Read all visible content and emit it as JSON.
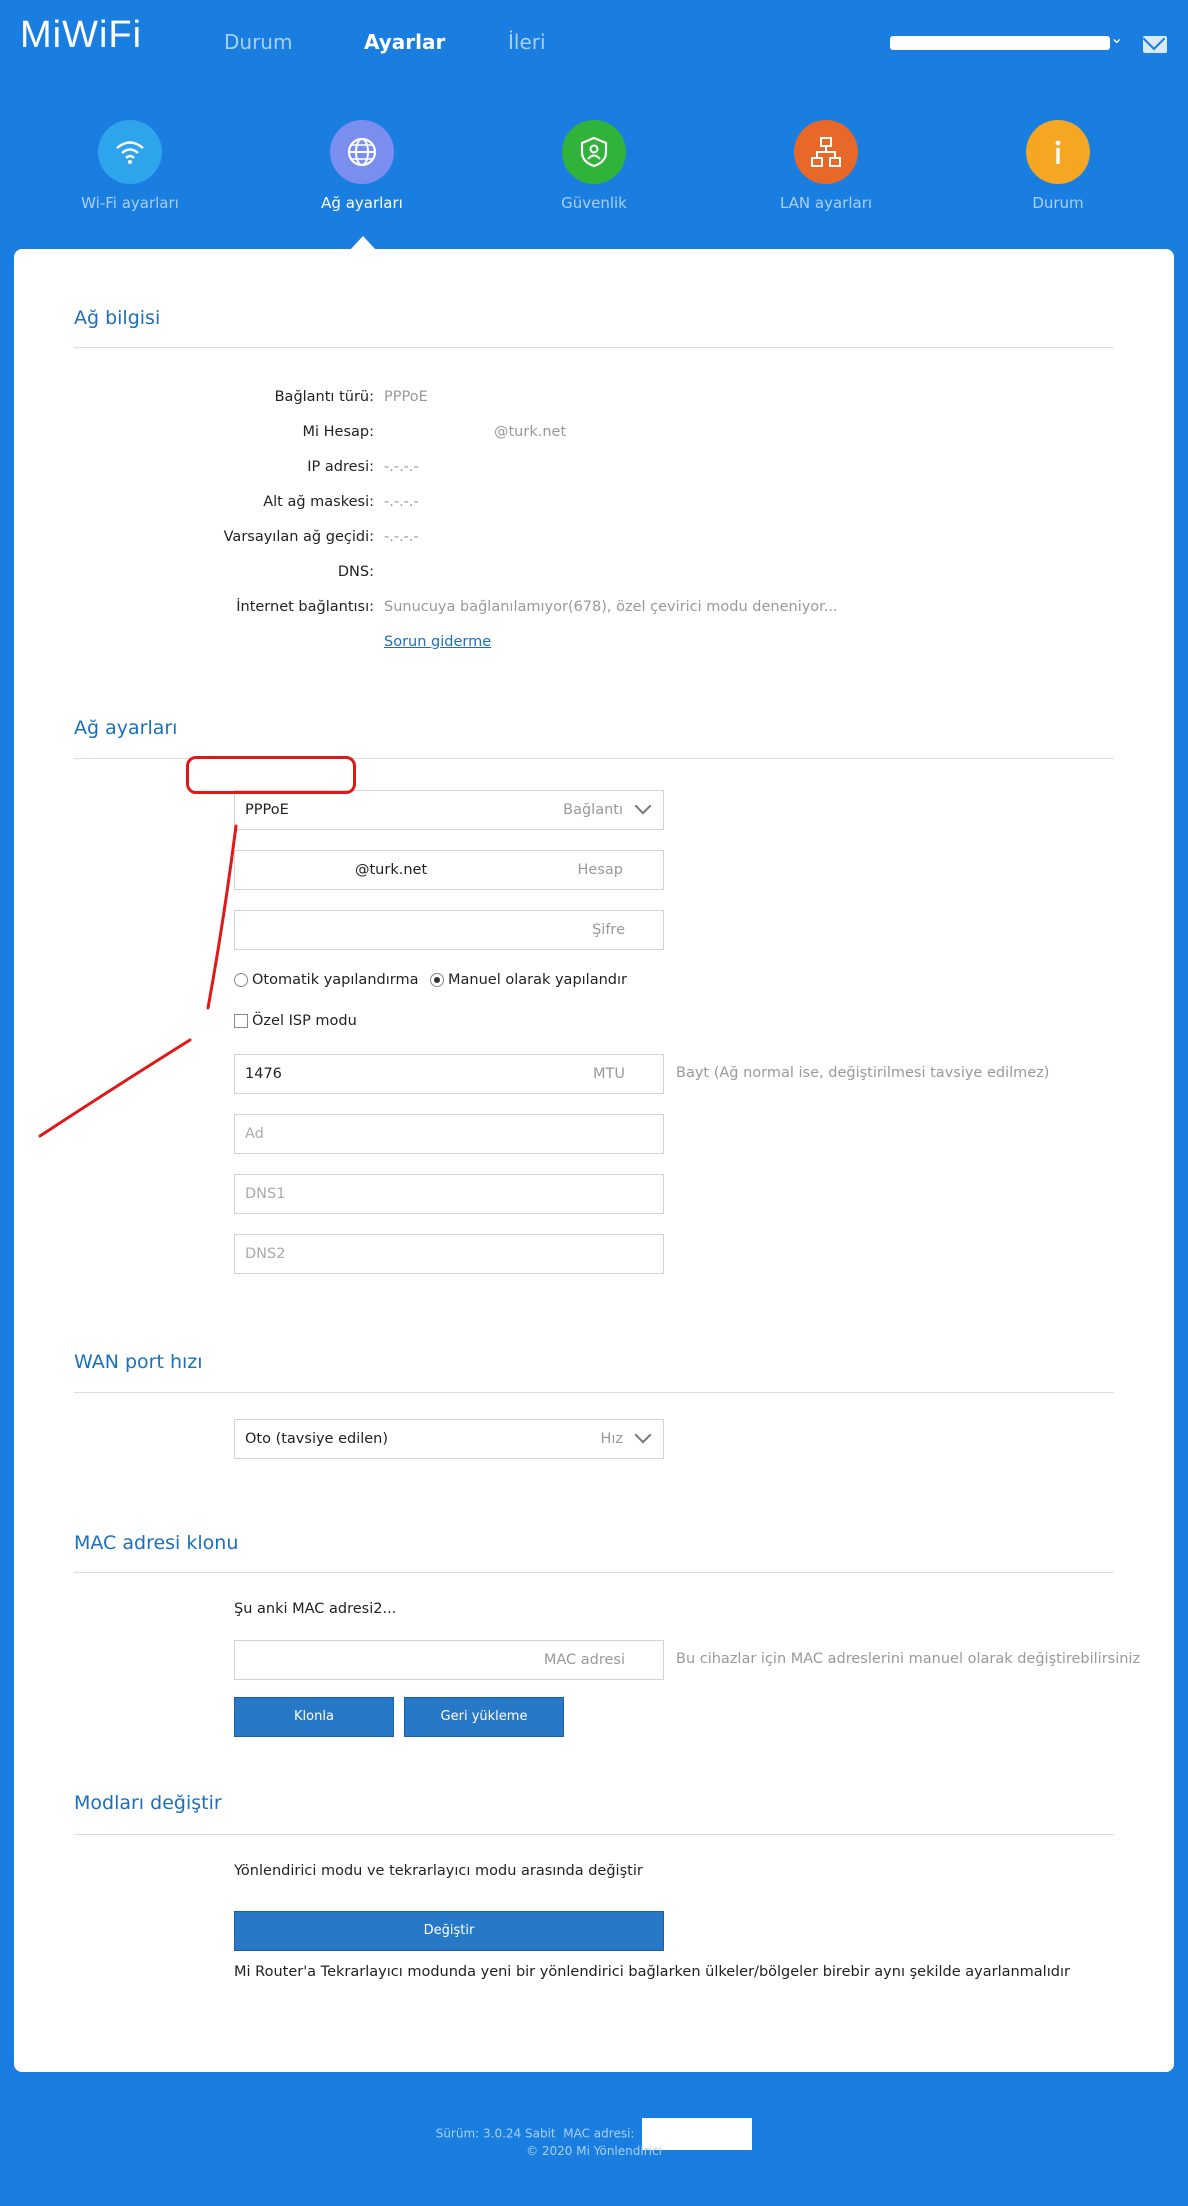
{
  "brand": {
    "logo": "MiWiFi"
  },
  "top_nav": [
    {
      "label": "Durum",
      "active": false
    },
    {
      "label": "Ayarlar",
      "active": true
    },
    {
      "label": "İleri",
      "active": false
    }
  ],
  "categories": [
    {
      "label": "Wi-Fi ayarları",
      "icon": "wifi-icon",
      "color": "#2ea4ec",
      "active": false
    },
    {
      "label": "Ağ ayarları",
      "icon": "globe-icon",
      "color": "#7a8ef0",
      "active": true
    },
    {
      "label": "Güvenlik",
      "icon": "shield-icon",
      "color": "#2fb33a",
      "active": false
    },
    {
      "label": "LAN ayarları",
      "icon": "network-icon",
      "color": "#e8682a",
      "active": false
    },
    {
      "label": "Durum",
      "icon": "info-icon",
      "color": "#f5a623",
      "active": false
    }
  ],
  "network_info": {
    "title": "Ağ bilgisi",
    "rows": [
      {
        "label": "Bağlantı türü:",
        "value": "PPPoE"
      },
      {
        "label": "Mi Hesap:",
        "value": "@turk.net"
      },
      {
        "label": "IP adresi:",
        "value": "-.-.-.-"
      },
      {
        "label": "Alt ağ maskesi:",
        "value": "-.-.-.-"
      },
      {
        "label": "Varsayılan ağ geçidi:",
        "value": "-.-.-.-"
      },
      {
        "label": "DNS:",
        "value": ""
      },
      {
        "label": "İnternet bağlantısı:",
        "value": "Sunucuya bağlanılamıyor(678), özel çevirici modu deneniyor..."
      }
    ],
    "troubleshoot_link": "Sorun giderme"
  },
  "network_settings": {
    "title": "Ağ ayarları",
    "connection": {
      "value": "PPPoE",
      "hint": "Bağlantı"
    },
    "account": {
      "value": "@turk.net",
      "hint": "Hesap"
    },
    "password": {
      "value": "",
      "hint": "Şifre"
    },
    "auto_config_label": "Otomatik yapılandırma",
    "manual_config_label": "Manuel olarak yapılandır",
    "custom_isp_label": "Özel ISP modu",
    "mtu": {
      "value": "1476",
      "hint": "MTU",
      "note": "Bayt (Ağ normal ise, değiştirilmesi tavsiye edilmez)"
    },
    "name_placeholder": "Ad",
    "dns1_placeholder": "DNS1",
    "dns2_placeholder": "DNS2"
  },
  "wan_port": {
    "title": "WAN port hızı",
    "speed": {
      "value": "Oto (tavsiye edilen)",
      "hint": "Hız"
    }
  },
  "mac_clone": {
    "title": "MAC adresi klonu",
    "current_label": "Şu anki MAC adresi2...",
    "field_hint": "MAC adresi",
    "note": "Bu cihazlar için MAC adreslerini manuel olarak değiştirebilirsiniz",
    "clone_button": "Klonla",
    "restore_button": "Geri yükleme"
  },
  "mode_switch": {
    "title": "Modları değiştir",
    "description": "Yönlendirici modu ve tekrarlayıcı modu arasında değiştir",
    "button": "Değiştir",
    "note": "Mi Router'a Tekrarlayıcı modunda yeni bir yönlendirici bağlarken ülkeler/bölgeler birebir aynı şekilde ayarlanmalıdır"
  },
  "footer": {
    "version": "Sürüm: 3.0.24 Sabit",
    "mac_label": "MAC adresi:",
    "copyright": "© 2020 Mi Yönlendirici"
  },
  "colors": {
    "background": "#1a7de0",
    "accent": "#1a6fbf",
    "button": "#2878c8",
    "annotation": "#e01818"
  }
}
